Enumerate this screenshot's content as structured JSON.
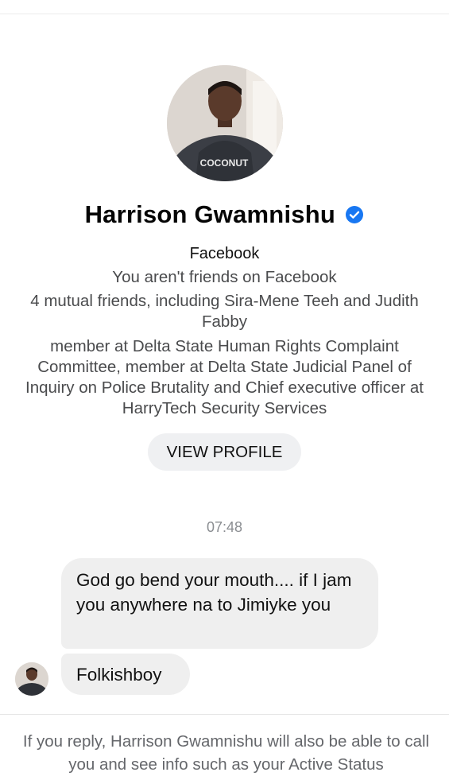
{
  "profile": {
    "name": "Harrison Gwamnishu",
    "verified": true,
    "source": "Facebook",
    "friend_status": "You aren't friends on Facebook",
    "mutual_friends": "4 mutual friends, including Sira-Mene Teeh and Judith Fabby",
    "bio": "member at Delta State Human Rights Complaint Committee, member at Delta State Judicial Panel of Inquiry on Police Brutality and Chief executive officer at HarryTech Security Services",
    "view_profile_label": "VIEW PROFILE",
    "hoodie_text": "COCONUT"
  },
  "conversation": {
    "timestamp": "07:48",
    "messages": [
      {
        "text": "God go bend your mouth.... if I jam you anywhere na to Jimiyke you"
      },
      {
        "text": "Folkishboy"
      }
    ]
  },
  "footer": {
    "reply_notice": "If you reply, Harrison Gwamnishu will also be able to call you and see info such as your Active Status"
  },
  "colors": {
    "verified_badge": "#1877f2",
    "bubble_background": "#efefef",
    "button_background": "#eff0f2",
    "secondary_text": "#65676b"
  },
  "icons": {
    "verified": "verified-badge-icon",
    "avatar": "profile-photo"
  }
}
